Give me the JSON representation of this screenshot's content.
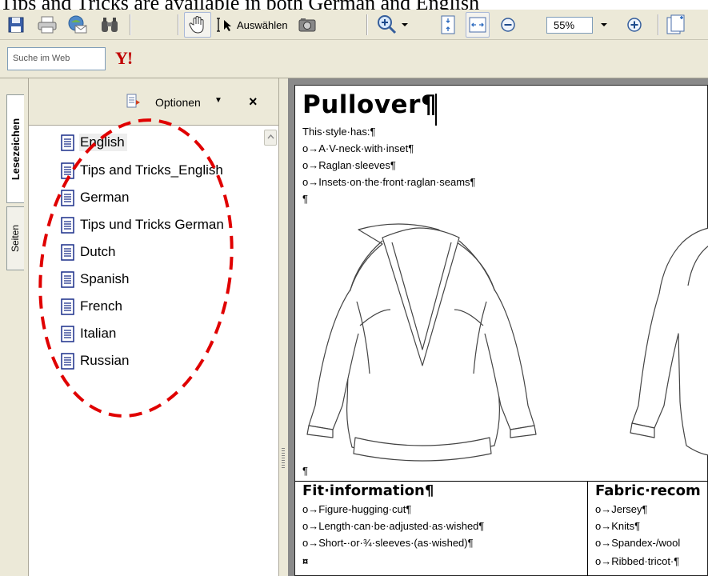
{
  "caption": "Tips and Tricks are available in both German and English",
  "toolbar": {
    "select_label": "Auswählen",
    "zoom_value": "55%",
    "icons": [
      "save-icon",
      "print-icon",
      "email-icon",
      "search-binoculars-icon",
      "hand-tool-icon",
      "select-tool-icon",
      "snapshot-icon",
      "zoom-in-icon",
      "fit-page-icon",
      "fit-width-icon",
      "zoom-out-icon",
      "zoom-plus-icon",
      "pages-icon"
    ]
  },
  "searchbar": {
    "placeholder": "Suche im Web",
    "yahoo_label": "Y!"
  },
  "side_tabs": {
    "bookmarks_label": "Lesezeichen",
    "pages_label": "Seiten"
  },
  "panel": {
    "options_label": "Optionen",
    "close_label": "×",
    "bookmarks": [
      {
        "label": "English",
        "selected": true
      },
      {
        "label": "Tips and Tricks_English"
      },
      {
        "label": "German"
      },
      {
        "label": "Tips und Tricks German"
      },
      {
        "label": "Dutch"
      },
      {
        "label": "Spanish"
      },
      {
        "label": "French"
      },
      {
        "label": "Italian"
      },
      {
        "label": "Russian"
      }
    ]
  },
  "document": {
    "title": "Pullover¶",
    "lines": [
      "This·style·has:¶",
      "o→A·V-neck·with·inset¶",
      "o→Raglan·sleeves¶",
      "o→Insets·on·the·front·raglan·seams¶",
      "¶"
    ],
    "pilcrow_after_sketch": "¶",
    "fit": {
      "title": "Fit·information¶",
      "lines": [
        "o→Figure-hugging·cut¶",
        "o→Length·can·be·adjusted·as·wished¶",
        "o→Short-·or·¾·sleeves·(as·wished)¶",
        "¤"
      ]
    },
    "fabric": {
      "title": "Fabric·recom",
      "lines": [
        "o→Jersey¶",
        "o→Knits¶",
        "o→Spandex-/wool",
        "o→Ribbed·tricot·¶"
      ]
    }
  },
  "colors": {
    "chrome": "#ece9d8",
    "annotation": "#e00000",
    "doc_background": "#8a8a8a"
  }
}
